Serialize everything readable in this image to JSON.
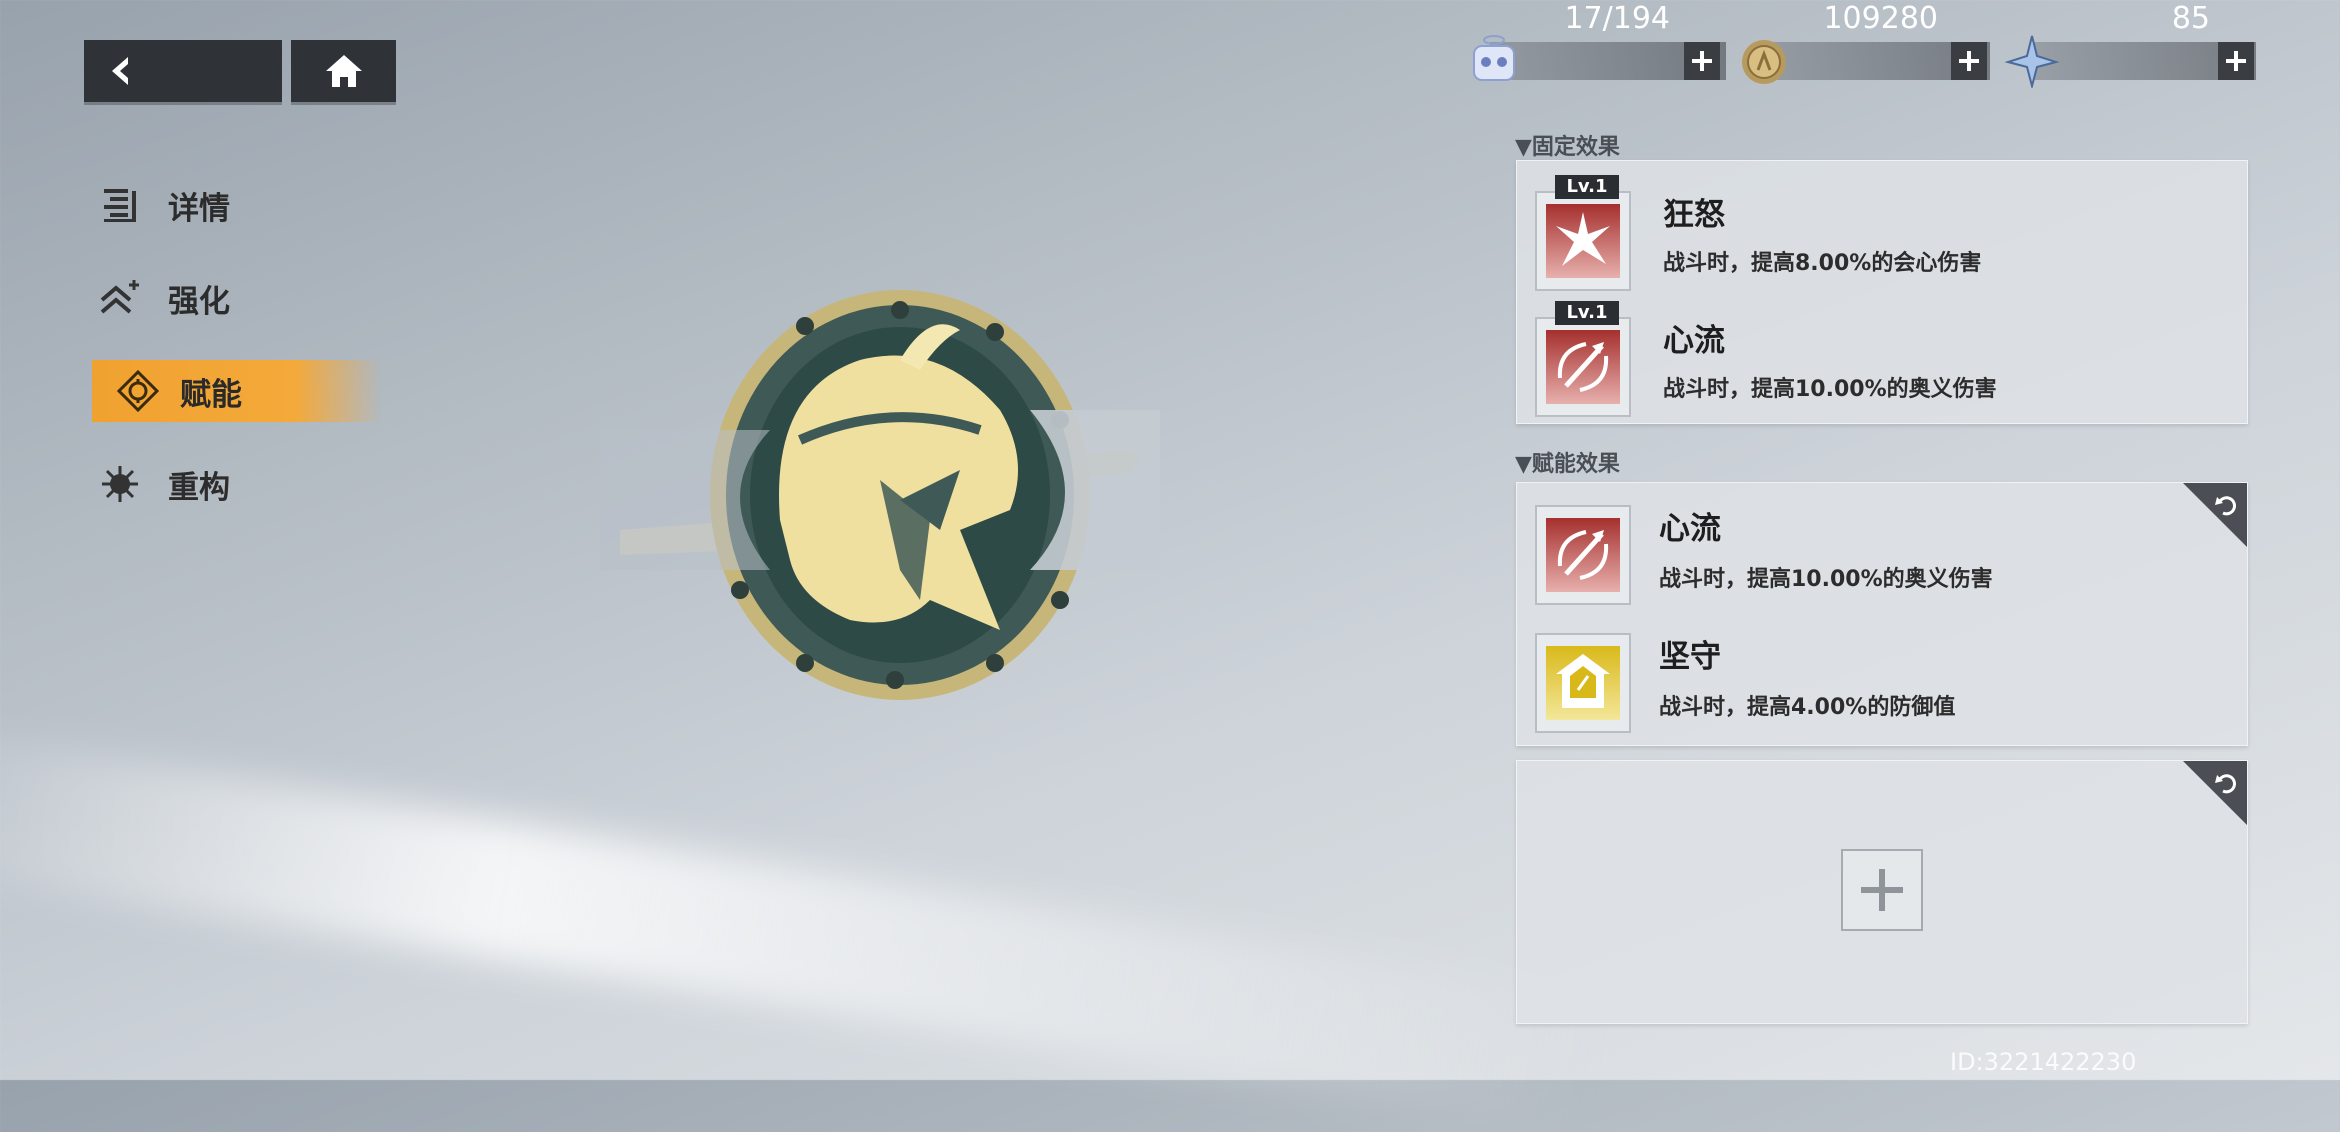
{
  "nav": {
    "items": [
      {
        "label": "详情",
        "icon": "details-icon"
      },
      {
        "label": "强化",
        "icon": "enhance-icon"
      },
      {
        "label": "赋能",
        "icon": "empower-icon",
        "active": true
      },
      {
        "label": "重构",
        "icon": "reconstruct-icon"
      }
    ]
  },
  "currencies": [
    {
      "icon": "stamina-icon",
      "value": "17/194"
    },
    {
      "icon": "coin-icon",
      "value": "109280"
    },
    {
      "icon": "crystal-icon",
      "value": "85"
    }
  ],
  "fixed_effects": {
    "title": "▼固定效果",
    "items": [
      {
        "level": "Lv.1",
        "name": "狂怒",
        "desc": "战斗时，提高8.00%的会心伤害",
        "icon": "rage-icon"
      },
      {
        "level": "Lv.1",
        "name": "心流",
        "desc": "战斗时，提高10.00%的奥义伤害",
        "icon": "flow-icon"
      }
    ]
  },
  "empower_effects": {
    "title": "▼赋能效果",
    "items": [
      {
        "name": "心流",
        "desc": "战斗时，提高10.00%的奥义伤害",
        "icon": "flow-icon"
      },
      {
        "name": "坚守",
        "desc": "战斗时，提高4.00%的防御值",
        "icon": "guard-icon"
      }
    ]
  },
  "footer": {
    "id_text": "ID:3221422230"
  },
  "colors": {
    "accent": "#f4a93a",
    "effect_red": "#b8403e",
    "effect_gold": "#e6c93a",
    "dark": "#2f3236"
  }
}
